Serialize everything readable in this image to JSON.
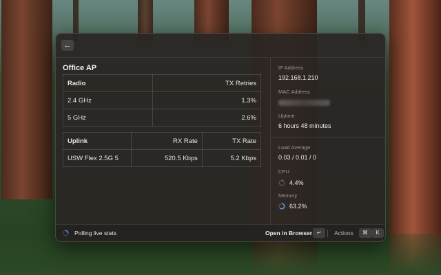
{
  "window": {
    "back_icon": "arrow-left-icon"
  },
  "device": {
    "title": "Office AP"
  },
  "radio_table": {
    "headers": [
      "Radio",
      "TX Retries"
    ],
    "rows": [
      [
        "2.4 GHz",
        "1.3%"
      ],
      [
        "5 GHz",
        "2.6%"
      ]
    ]
  },
  "uplink_table": {
    "headers": [
      "Uplink",
      "RX Rate",
      "TX Rate"
    ],
    "rows": [
      [
        "USW Flex 2.5G 5",
        "520.5 Kbps",
        "5.2 Kbps"
      ]
    ]
  },
  "side": {
    "ip_label": "IP Address",
    "ip_value": "192.168.1.210",
    "mac_label": "MAC Address",
    "uptime_label": "Uptime",
    "uptime_value": "6 hours 48 minutes",
    "load_label": "Load Average",
    "load_value": "0.03 / 0.01 / 0",
    "cpu_label": "CPU",
    "cpu_value": "4.4%",
    "cpu_fraction": 0.044,
    "memory_label": "Memory",
    "memory_value": "63.2%",
    "memory_fraction": 0.632
  },
  "bottombar": {
    "status": "Polling live stats",
    "open_label": "Open in Browser",
    "enter_key": "↵",
    "actions_label": "Actions",
    "cmd_key": "⌘",
    "k_key": "K"
  },
  "colors": {
    "accent": "#5aa0f0",
    "panel": "#2a2624"
  }
}
